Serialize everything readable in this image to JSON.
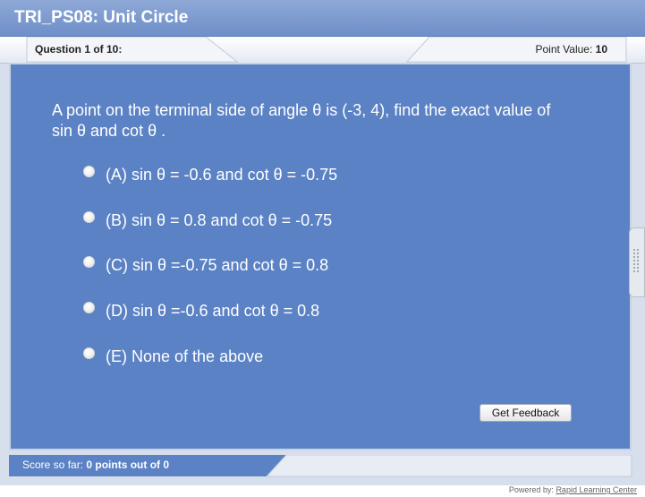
{
  "window": {
    "title": "TRI_PS08: Unit Circle"
  },
  "header": {
    "question_count": "Question 1 of 10:",
    "point_value_label": "Point Value:",
    "point_value": "10"
  },
  "question": {
    "text": "A point on the terminal side of angle θ is (-3, 4), find the exact value of sin θ and cot θ  .",
    "options": [
      {
        "label": "(A) sin θ = -0.6 and cot θ = -0.75"
      },
      {
        "label": "(B) sin θ = 0.8 and cot θ = -0.75"
      },
      {
        "label": "(C) sin θ =-0.75 and cot θ = 0.8"
      },
      {
        "label": "(D) sin θ =-0.6 and cot θ = 0.8"
      },
      {
        "label": "(E) None of the above"
      }
    ]
  },
  "actions": {
    "feedback_label": "Get Feedback"
  },
  "footer": {
    "score_label": "Score so far:",
    "score_value": "0 points out of 0",
    "powered_by_label": "Powered by:",
    "powered_by_link": "Rapid Learning Center"
  },
  "colors": {
    "title_bar": "#7896cd",
    "panel": "#5b82c4",
    "frame": "#d7dfec"
  }
}
